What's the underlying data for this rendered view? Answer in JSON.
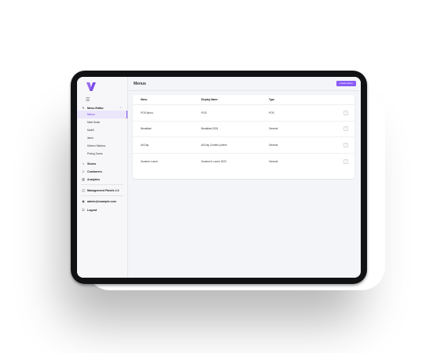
{
  "sidebar": {
    "menu_icon": "hamburger-icon",
    "groups": [
      {
        "label": "Menu Editor",
        "expanded": true,
        "icon": "pencil-icon"
      }
    ],
    "sub_items": [
      {
        "label": "Menus",
        "active": true
      },
      {
        "label": "Meal Deals"
      },
      {
        "label": "Modifi"
      },
      {
        "label": "Items"
      },
      {
        "label": "Kitchen Stations"
      },
      {
        "label": "Pricing Zones"
      }
    ],
    "nav": [
      {
        "label": "Stores",
        "icon": "store-icon"
      },
      {
        "label": "Customers",
        "icon": "users-icon"
      },
      {
        "label": "Analytics",
        "icon": "chart-icon"
      }
    ],
    "workspace": {
      "label": "Management Panels 1.0",
      "icon": "layers-icon"
    },
    "account": {
      "label": "admin@example.com",
      "icon": "user-icon"
    },
    "logout": {
      "label": "Logout",
      "icon": "logout-icon"
    }
  },
  "header": {
    "title": "Menus",
    "create_button": "Create Menu"
  },
  "table": {
    "columns": [
      "Menu",
      "Display Name",
      "Type"
    ],
    "rows": [
      {
        "menu": "POS Menu",
        "display": "POS",
        "type": "POS"
      },
      {
        "menu": "Breakfast",
        "display": "Breakfast 2024",
        "type": "General"
      },
      {
        "menu": "All Day",
        "display": "All Day Content (online",
        "type": "General"
      },
      {
        "menu": "Summer Lunch",
        "display": "Summer's Lunch 2023",
        "type": "General"
      }
    ],
    "row_action_icon": "kebab-icon"
  },
  "colors": {
    "accent": "#8b5cf6",
    "active_bg": "#ece6fb"
  }
}
